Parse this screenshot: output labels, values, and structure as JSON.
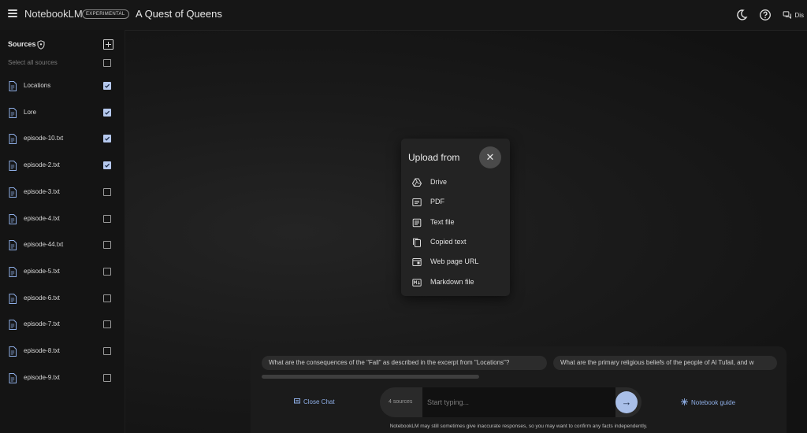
{
  "app": {
    "name": "NotebookLM",
    "badge": "EXPERIMENTAL",
    "title": "A Quest of Queens"
  },
  "topbar": {
    "display_label": "Dis"
  },
  "sidebar": {
    "heading": "Sources",
    "select_all": "Select all sources",
    "items": [
      {
        "label": "Locations",
        "checked": true
      },
      {
        "label": "Lore",
        "checked": true
      },
      {
        "label": "episode-10.txt",
        "checked": true
      },
      {
        "label": "episode-2.txt",
        "checked": true
      },
      {
        "label": "episode-3.txt",
        "checked": false
      },
      {
        "label": "episode-4.txt",
        "checked": false
      },
      {
        "label": "episode-44.txt",
        "checked": false
      },
      {
        "label": "episode-5.txt",
        "checked": false
      },
      {
        "label": "episode-6.txt",
        "checked": false
      },
      {
        "label": "episode-7.txt",
        "checked": false
      },
      {
        "label": "episode-8.txt",
        "checked": false
      },
      {
        "label": "episode-9.txt",
        "checked": false
      }
    ]
  },
  "modal": {
    "title": "Upload from",
    "close_glyph": "✕",
    "options": [
      {
        "label": "Drive",
        "icon": "drive-icon"
      },
      {
        "label": "PDF",
        "icon": "pdf-icon"
      },
      {
        "label": "Text file",
        "icon": "text-file-icon"
      },
      {
        "label": "Copied text",
        "icon": "copy-icon"
      },
      {
        "label": "Web page URL",
        "icon": "web-page-icon"
      },
      {
        "label": "Markdown file",
        "icon": "markdown-icon"
      }
    ]
  },
  "chat": {
    "suggestions": [
      "What are the consequences of the \"Fall\" as described in the excerpt from \"Locations\"?",
      "What are the primary religious beliefs of the people of Al Tufail, and w"
    ],
    "close_chat": "Close Chat",
    "source_count": "4 sources",
    "placeholder": "Start typing...",
    "send_glyph": "→",
    "notebook_guide": "Notebook guide",
    "disclaimer": "NotebookLM may still sometimes give inaccurate responses, so you may want to confirm any facts independently."
  },
  "colors": {
    "accent": "#8eaee6",
    "checkbox_checked": "#b6c9ee",
    "send_button": "#a9bfe8"
  }
}
